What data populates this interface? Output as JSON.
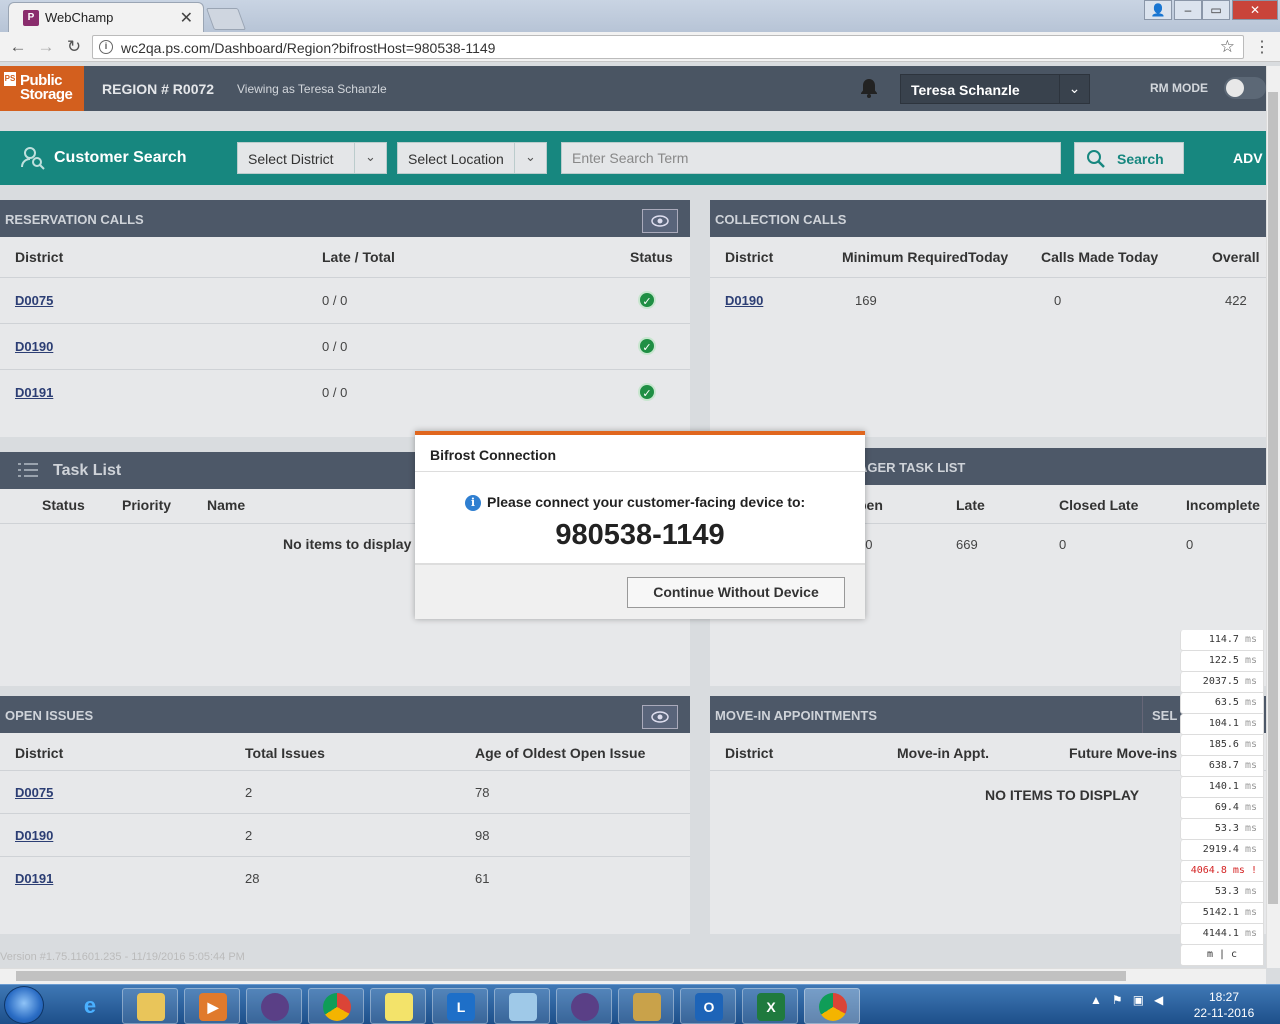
{
  "browser": {
    "tab_title": "WebChamp",
    "url": "wc2qa.ps.com/Dashboard/Region?bifrostHost=980538-1149"
  },
  "header": {
    "logo_line1": "Public",
    "logo_line2": "Storage",
    "region": "REGION # R0072",
    "viewing_as": "Viewing as Teresa Schanzle",
    "user_name": "Teresa Schanzle",
    "rm_mode_label": "RM MODE"
  },
  "search": {
    "label": "Customer Search",
    "district_select": "Select District",
    "location_select": "Select Location",
    "placeholder": "Enter Search Term",
    "button": "Search",
    "advanced": "ADV"
  },
  "reservation_calls": {
    "title": "RESERVATION CALLS",
    "columns": [
      "District",
      "Late / Total",
      "Status"
    ],
    "rows": [
      {
        "district": "D0075",
        "late_total": "0 / 0"
      },
      {
        "district": "D0190",
        "late_total": "0 / 0"
      },
      {
        "district": "D0191",
        "late_total": "0 / 0"
      }
    ]
  },
  "collection_calls": {
    "title": "COLLECTION CALLS",
    "columns": [
      "District",
      "Minimum RequiredToday",
      "Calls Made Today",
      "Overall"
    ],
    "rows": [
      {
        "district": "D0190",
        "min_required": "169",
        "calls_made": "0",
        "overall": "422"
      }
    ]
  },
  "task_list": {
    "title": "Task List",
    "columns": [
      "Status",
      "Priority",
      "Name"
    ],
    "empty": "No items to display"
  },
  "manager_task_list": {
    "title": "AGER TASK LIST",
    "columns": [
      "pen",
      "Late",
      "Closed Late",
      "Incomplete"
    ],
    "row": {
      "open": "70",
      "late": "669",
      "closed_late": "0",
      "incomplete": "0"
    }
  },
  "open_issues": {
    "title": "OPEN ISSUES",
    "columns": [
      "District",
      "Total Issues",
      "Age of Oldest Open Issue"
    ],
    "rows": [
      {
        "district": "D0075",
        "total": "2",
        "age": "78"
      },
      {
        "district": "D0190",
        "total": "2",
        "age": "98"
      },
      {
        "district": "D0191",
        "total": "28",
        "age": "61"
      }
    ]
  },
  "move_in": {
    "title": "MOVE-IN APPOINTMENTS",
    "select_label": "SEL",
    "columns": [
      "District",
      "Move-in Appt.",
      "Future Move-ins"
    ],
    "empty": "NO ITEMS TO DISPLAY"
  },
  "modal": {
    "title": "Bifrost Connection",
    "message": "Please connect your customer-facing device to:",
    "code": "980538-1149",
    "button": "Continue Without Device"
  },
  "timings": [
    {
      "value": "114.7",
      "unit": "ms"
    },
    {
      "value": "122.5",
      "unit": "ms"
    },
    {
      "value": "2037.5",
      "unit": "ms"
    },
    {
      "value": "63.5",
      "unit": "ms"
    },
    {
      "value": "104.1",
      "unit": "ms"
    },
    {
      "value": "185.6",
      "unit": "ms"
    },
    {
      "value": "638.7",
      "unit": "ms"
    },
    {
      "value": "140.1",
      "unit": "ms"
    },
    {
      "value": "69.4",
      "unit": "ms"
    },
    {
      "value": "53.3",
      "unit": "ms"
    },
    {
      "value": "2919.4",
      "unit": "ms"
    },
    {
      "value": "4064.8",
      "unit": "ms !"
    },
    {
      "value": "53.3",
      "unit": "ms"
    },
    {
      "value": "5142.1",
      "unit": "ms"
    },
    {
      "value": "4144.1",
      "unit": "ms"
    }
  ],
  "timing_footer": "m | c",
  "version": "Version #1.75.11601.235 - 11/19/2016 5:05:44 PM",
  "taskbar": {
    "time": "18:27",
    "date": "22-11-2016"
  }
}
